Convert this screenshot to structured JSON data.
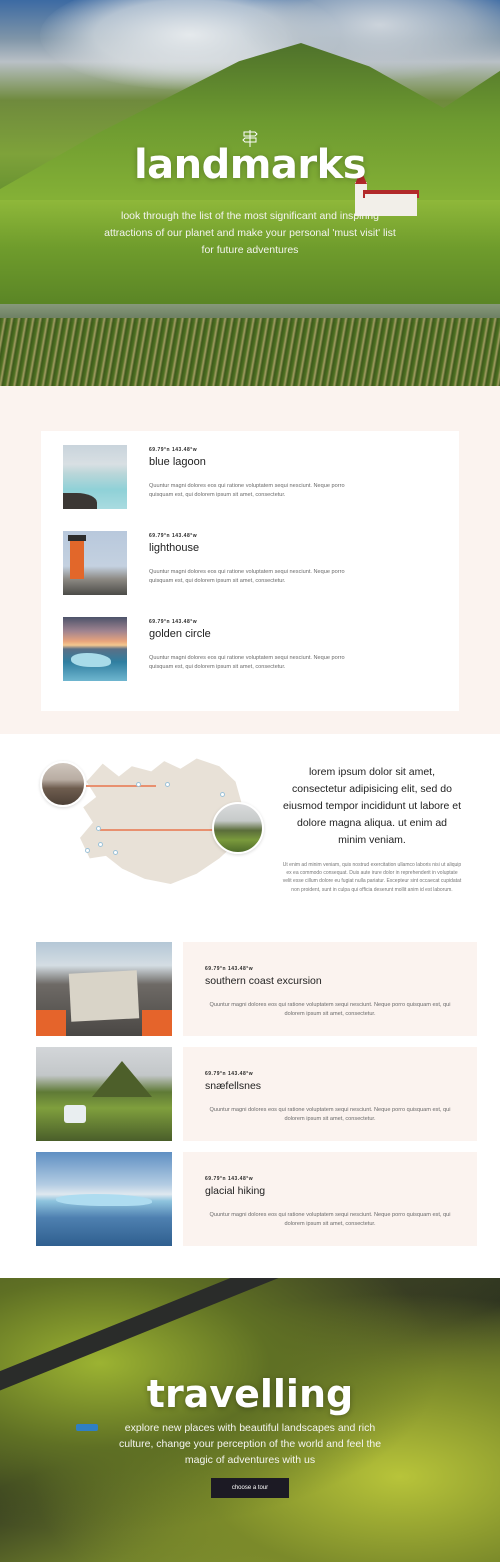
{
  "hero": {
    "title": "landmarks",
    "subtitle": "look through the list of the most significant and inspiring attractions of our planet and make your personal 'must visit' list for future adventures",
    "icon": "signpost-icon"
  },
  "landmarks": [
    {
      "coords": "69.79°n 143.48°w",
      "title": "blue lagoon",
      "desc": "Quuntur magni dolores eos qui ratione voluptatem sequi nesciunt. Neque porro quisquam est, qui dolorem ipsum sit amet, consectetur."
    },
    {
      "coords": "69.79°n 143.48°w",
      "title": "lighthouse",
      "desc": "Quuntur magni dolores eos qui ratione voluptatem sequi nesciunt. Neque porro quisquam est, qui dolorem ipsum sit amet, consectetur."
    },
    {
      "coords": "69.79°n 143.48°w",
      "title": "golden circle",
      "desc": "Quuntur magni dolores eos qui ratione voluptatem sequi nesciunt. Neque porro quisquam est, qui dolorem ipsum sit amet, consectetur."
    }
  ],
  "map_section": {
    "lead": "lorem ipsum dolor sit amet, consectetur adipisicing elit, sed do eiusmod tempor incididunt ut labore et dolore magna aliqua. ut enim ad minim veniam.",
    "body": "Ut enim ad minim veniam, quis nostrud exercitation ullamco laboris nisi ut aliquip ex ea commodo consequat. Duis aute irure dolor in reprehenderit in voluptate velit esse cillum dolore eu fugiat nulla pariatur. Excepteur sint occaecat cupidatat non proident, sunt in culpa qui officia deserunt mollit anim id est laborum."
  },
  "tours": [
    {
      "coords": "69.79°n 143.48°w",
      "title": "southern coast excursion",
      "desc": "Quuntur magni dolores eos qui ratione voluptatem sequi nesciunt. Neque porro quisquam est, qui dolorem ipsum sit amet, consectetur."
    },
    {
      "coords": "69.79°n 143.48°w",
      "title": "snæfellsnes",
      "desc": "Quuntur magni dolores eos qui ratione voluptatem sequi nesciunt. Neque porro quisquam est, qui dolorem ipsum sit amet, consectetur."
    },
    {
      "coords": "69.79°n 143.48°w",
      "title": "glacial hiking",
      "desc": "Quuntur magni dolores eos qui ratione voluptatem sequi nesciunt. Neque porro quisquam est, qui dolorem ipsum sit amet, consectetur."
    }
  ],
  "travel": {
    "title": "travelling",
    "subtitle": "explore new places with beautiful landscapes and rich culture, change your perception of the world and feel the magic of adventures with us",
    "button": "choose a tour"
  },
  "colors": {
    "accent": "#e8906f",
    "section_bg": "#fbf3ef",
    "button_bg": "#1c1a24"
  }
}
